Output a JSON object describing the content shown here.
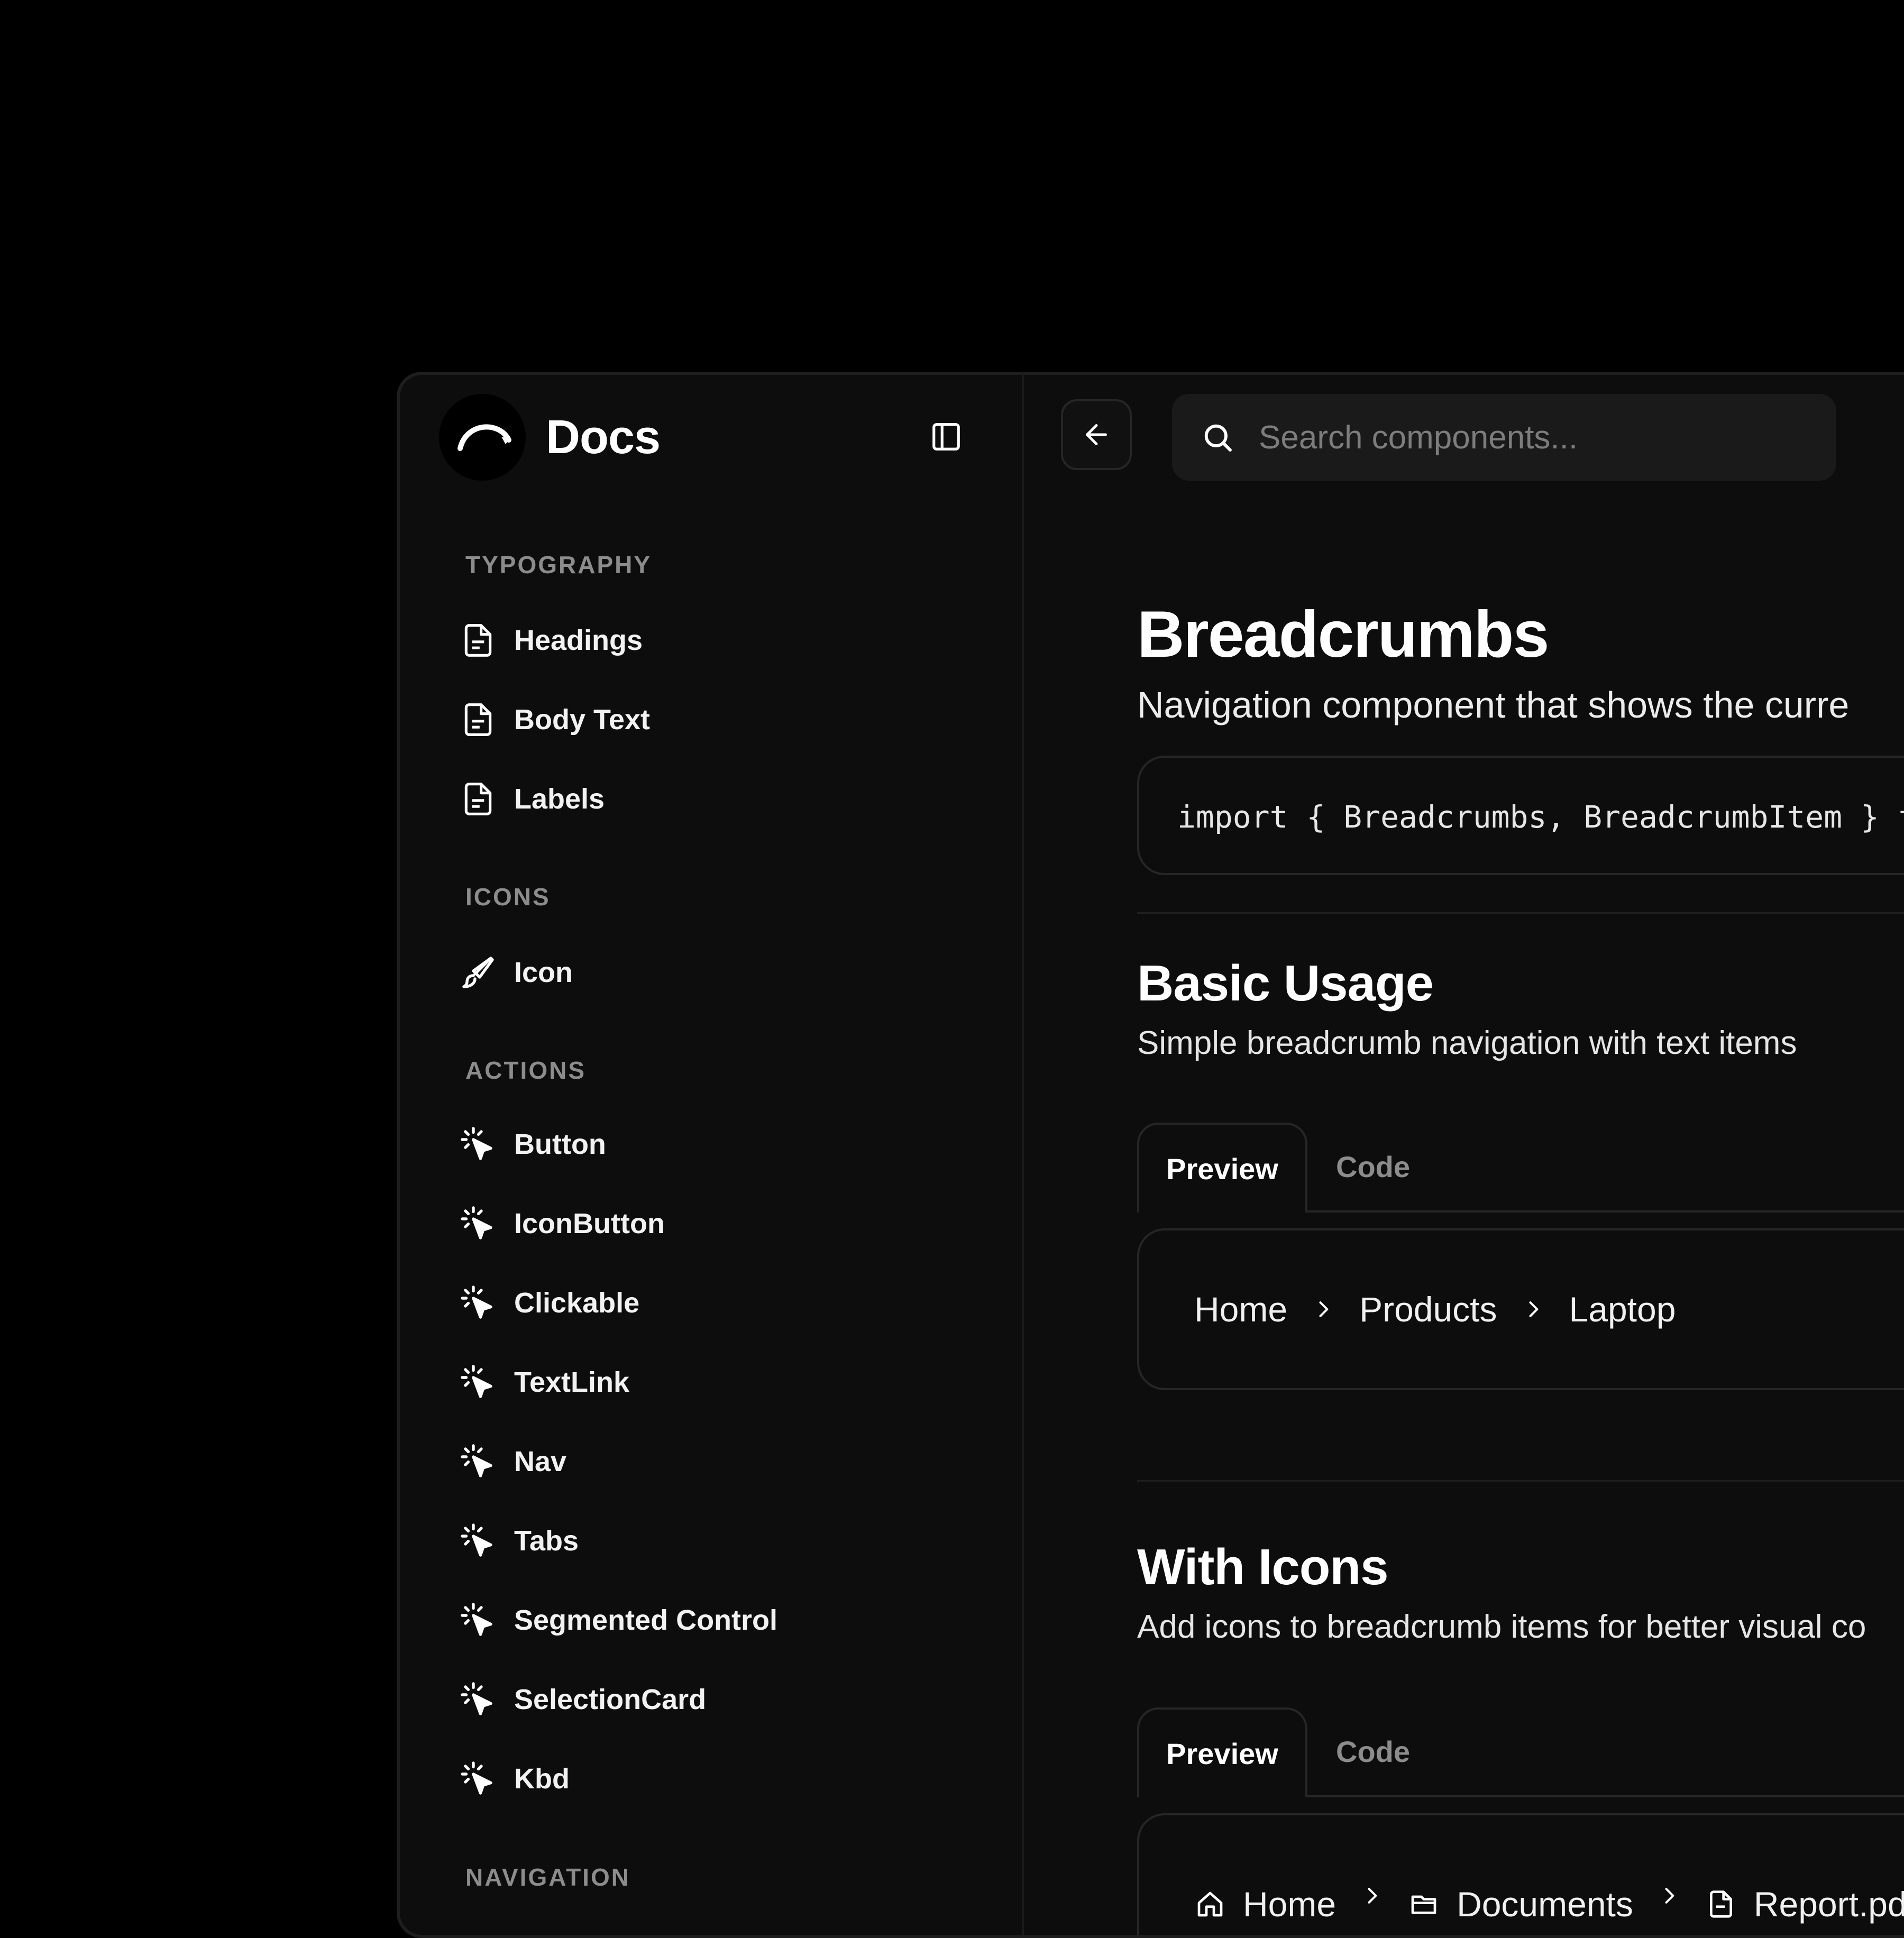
{
  "app": {
    "name": "Docs"
  },
  "search": {
    "placeholder": "Search components..."
  },
  "sidebar": {
    "sections": [
      {
        "heading": "TYPOGRAPHY",
        "items": [
          "Headings",
          "Body Text",
          "Labels"
        ]
      },
      {
        "heading": "ICONS",
        "items": [
          "Icon"
        ]
      },
      {
        "heading": "ACTIONS",
        "items": [
          "Button",
          "IconButton",
          "Clickable",
          "TextLink",
          "Nav",
          "Tabs",
          "Segmented Control",
          "SelectionCard",
          "Kbd"
        ]
      },
      {
        "heading": "NAVIGATION",
        "items": []
      }
    ]
  },
  "page": {
    "title": "Breadcrumbs",
    "subtitle": "Navigation component that shows the curre",
    "import_code": "import { Breadcrumbs, BreadcrumbItem } f"
  },
  "sections": [
    {
      "title": "Basic Usage",
      "description": "Simple breadcrumb navigation with text items",
      "tabs": [
        "Preview",
        "Code"
      ],
      "breadcrumbs": [
        "Home",
        "Products",
        "Laptop"
      ]
    },
    {
      "title": "With Icons",
      "description": "Add icons to breadcrumb items for better visual co",
      "tabs": [
        "Preview",
        "Code"
      ],
      "breadcrumbs": [
        {
          "icon": "home-icon",
          "label": "Home"
        },
        {
          "icon": "folder-icon",
          "label": "Documents"
        },
        {
          "icon": "file-icon",
          "label": "Report.pdf"
        }
      ]
    }
  ],
  "colors": {
    "background": "#000000",
    "window": "#0d0d0d",
    "border": "#262626",
    "muted_text": "#8c8c8c"
  }
}
